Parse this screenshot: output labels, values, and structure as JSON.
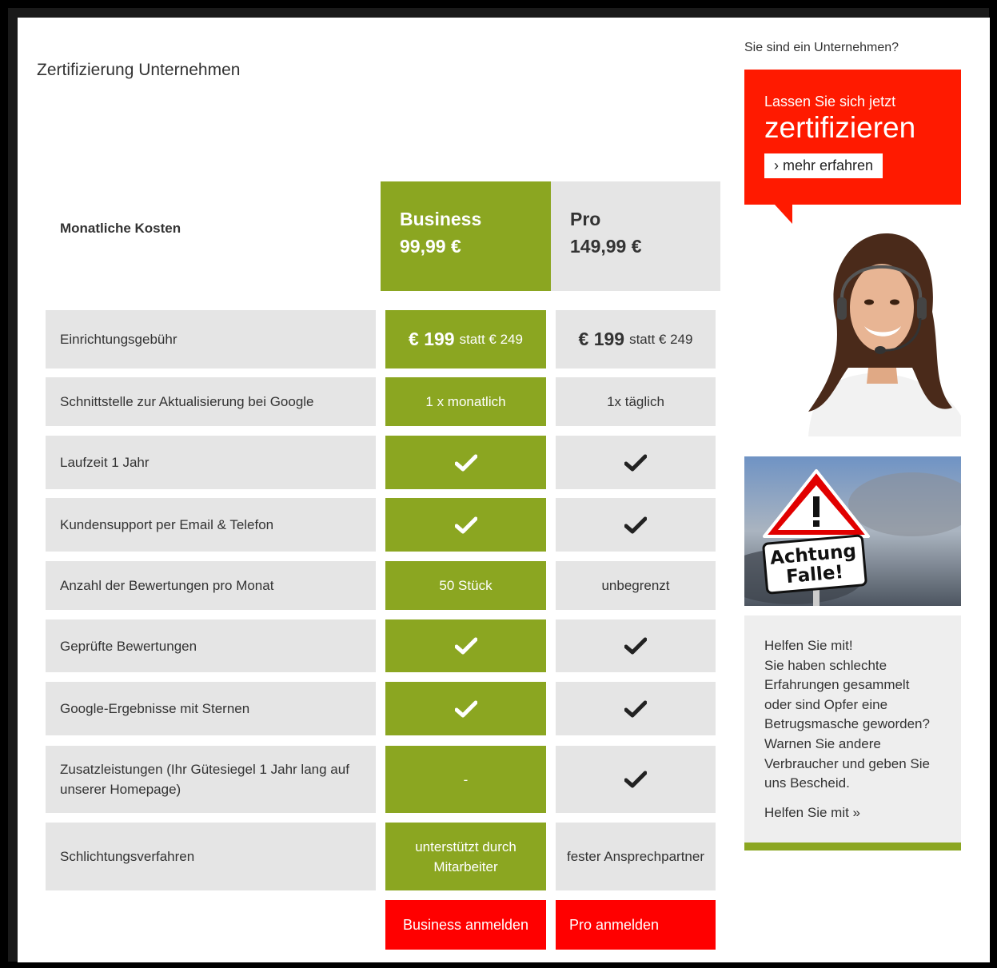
{
  "page": {
    "title": "Zertifizierung Unternehmen",
    "cost_label": "Monatliche Kosten"
  },
  "plans": {
    "business": {
      "name": "Business",
      "price": "99,99 €"
    },
    "pro": {
      "name": "Pro",
      "price": "149,99 €"
    }
  },
  "fee": {
    "label": "Einrichtungsgebühr",
    "business": {
      "price": "€ 199",
      "old": "statt € 249"
    },
    "pro": {
      "price": "€ 199",
      "old": "statt € 249"
    }
  },
  "rows": [
    {
      "label": "Schnittstelle zur Aktualisierung bei Google",
      "business": "1 x monatlich",
      "pro": "1x täglich"
    },
    {
      "label": "Laufzeit 1 Jahr",
      "business": "check-icon",
      "pro": "check-icon"
    },
    {
      "label": "Kundensupport per Email & Telefon",
      "business": "check-icon",
      "pro": "check-icon"
    },
    {
      "label": "Anzahl der Bewertungen pro Monat",
      "business": "50 Stück",
      "pro": "unbegrenzt"
    },
    {
      "label": "Geprüfte Bewertungen",
      "business": "check-icon",
      "pro": "check-icon"
    },
    {
      "label": "Google-Ergebnisse mit Sternen",
      "business": "check-icon",
      "pro": "check-icon"
    },
    {
      "label": "Zusatzleistungen (Ihr Gütesiegel 1 Jahr lang auf unserer Homepage)",
      "business": "-",
      "pro": "check-icon"
    },
    {
      "label": "Schlichtungsverfahren",
      "business": "unterstützt durch Mitarbeiter",
      "pro": "fester Ansprechpartner"
    }
  ],
  "buttons": {
    "business": "Business anmelden",
    "pro": "Pro anmelden"
  },
  "sidebar": {
    "question": "Sie sind ein Unternehmen?",
    "promo_line1": "Lassen Sie sich jetzt",
    "promo_line2": "zertifizieren",
    "promo_button": "› mehr erfahren",
    "warning_sign_line1": "Achtung",
    "warning_sign_line2": "Falle!",
    "help_text": [
      "Helfen Sie mit!",
      "Sie haben schlechte",
      "Erfahrungen gesammelt",
      "oder sind Opfer eine",
      "Betrugsmasche geworden?",
      "Warnen Sie andere",
      "Verbraucher und geben Sie",
      "uns Bescheid."
    ],
    "help_link": "Helfen Sie mit »"
  },
  "colors": {
    "green": "#8ba621",
    "red": "#ff1a00",
    "gray": "#e5e5e5"
  }
}
